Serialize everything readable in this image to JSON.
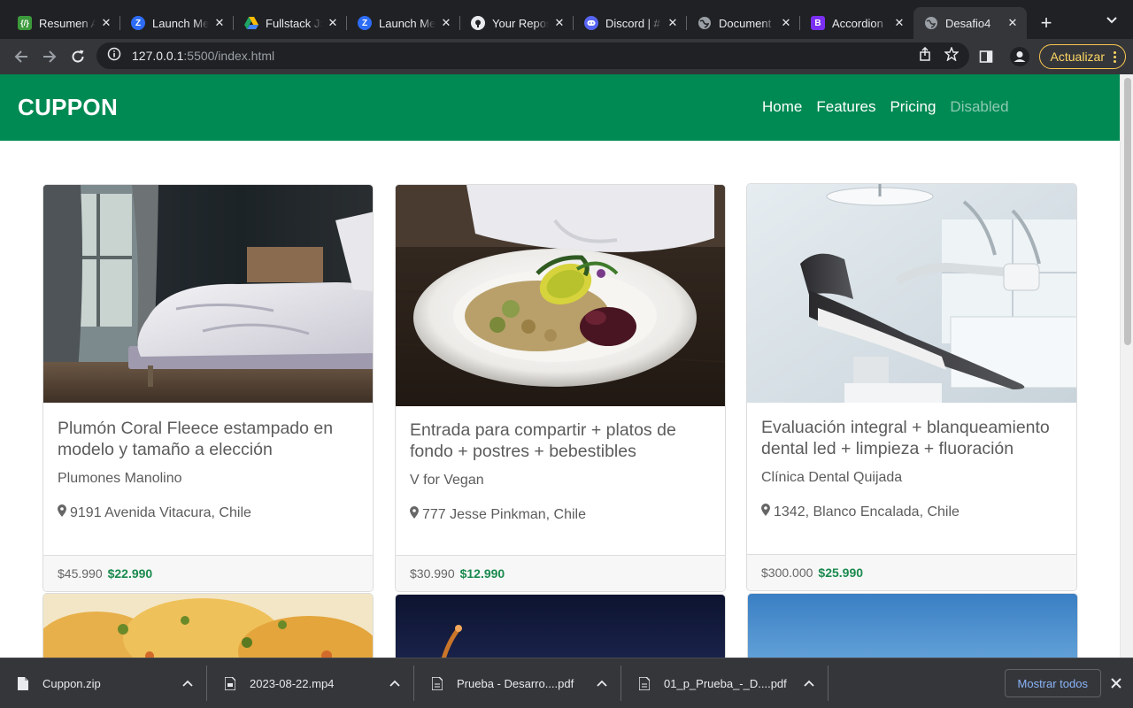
{
  "browser": {
    "tabs": [
      {
        "title": "Resumen A",
        "favicon": "code-icon",
        "favicon_color": "#3c9a3c",
        "favicon_glyph": "{/}"
      },
      {
        "title": "Launch Me",
        "favicon": "zoom-icon",
        "favicon_color": "#2d6cf6",
        "favicon_glyph": "Z"
      },
      {
        "title": "Fullstack JS",
        "favicon": "google-drive-icon",
        "favicon_color": "",
        "favicon_glyph": ""
      },
      {
        "title": "Launch Me",
        "favicon": "zoom-icon",
        "favicon_color": "#2d6cf6",
        "favicon_glyph": "Z"
      },
      {
        "title": "Your Repos",
        "favicon": "github-icon",
        "favicon_color": "#e8eaed",
        "favicon_glyph": ""
      },
      {
        "title": "Discord | #",
        "favicon": "discord-icon",
        "favicon_color": "#5865f2",
        "favicon_glyph": ""
      },
      {
        "title": "Document",
        "favicon": "globe-icon",
        "favicon_color": "#9aa0a6",
        "favicon_glyph": ""
      },
      {
        "title": "Accordion",
        "favicon": "bootstrap-icon",
        "favicon_color": "#7b2ff2",
        "favicon_glyph": "B"
      },
      {
        "title": "Desafio4",
        "favicon": "globe-icon",
        "favicon_color": "#9aa0a6",
        "favicon_glyph": "",
        "active": true
      }
    ],
    "address": {
      "host": "127.0.0.1",
      "rest": ":5500/index.html"
    },
    "update_label": "Actualizar"
  },
  "page": {
    "brand": "CUPPON",
    "nav": [
      "Home",
      "Features",
      "Pricing",
      "Disabled"
    ],
    "cards": [
      {
        "title": "Plumón Coral Fleece estampado en modelo y tamaño a elección",
        "provider": "Plumones Manolino",
        "location": "9191 Avenida Vitacura, Chile",
        "old_price": "$45.990",
        "new_price": "$22.990",
        "image": "bedroom-photo"
      },
      {
        "title": "Entrada para compartir + platos de fondo + postres + bebestibles",
        "provider": "V for Vegan",
        "location": "777 Jesse Pinkman, Chile",
        "old_price": "$30.990",
        "new_price": "$12.990",
        "image": "vegan-food-photo"
      },
      {
        "title": "Evaluación integral + blanqueamiento dental led + limpieza + fluoración",
        "provider": "Clínica Dental Quijada",
        "location": "1342, Blanco Encalada, Chile",
        "old_price": "$300.000",
        "new_price": "$25.990",
        "image": "dental-chair-photo"
      }
    ],
    "accent_color": "#008a53",
    "price_color": "#1a8a4e"
  },
  "downloads": {
    "items": [
      {
        "name": "Cuppon.zip",
        "icon": "zip-file-icon"
      },
      {
        "name": "2023-08-22.mp4",
        "icon": "video-file-icon"
      },
      {
        "name": "Prueba - Desarro....pdf",
        "icon": "pdf-file-icon"
      },
      {
        "name": "01_p_Prueba_-_D....pdf",
        "icon": "pdf-file-icon"
      }
    ],
    "show_all": "Mostrar todos"
  }
}
